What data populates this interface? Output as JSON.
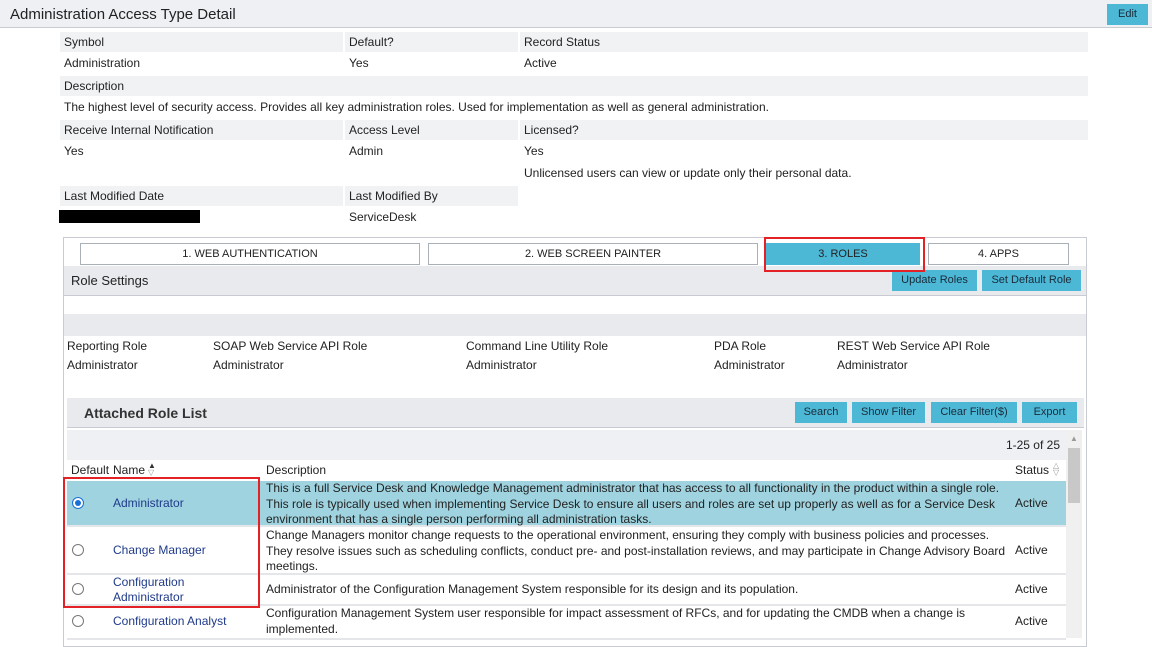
{
  "header": {
    "title": "Administration Access Type Detail",
    "edit_label": "Edit"
  },
  "detail": {
    "symbol_label": "Symbol",
    "symbol": "Administration",
    "default_label": "Default?",
    "default": "Yes",
    "record_status_label": "Record Status",
    "record_status": "Active",
    "description_label": "Description",
    "description": "The highest level of security access. Provides all key administration roles. Used for implementation as well as general administration.",
    "notification_label": "Receive Internal Notification",
    "notification": "Yes",
    "access_level_label": "Access Level",
    "access_level": "Admin",
    "licensed_label": "Licensed?",
    "licensed": "Yes",
    "licensed_note": "Unlicensed users can view or update only their personal data.",
    "modified_date_label": "Last Modified Date",
    "modified_by_label": "Last Modified By",
    "modified_by": "ServiceDesk"
  },
  "tabs": [
    {
      "label": "1. WEB AUTHENTICATION"
    },
    {
      "label": "2. WEB SCREEN PAINTER"
    },
    {
      "label": "3. ROLES"
    },
    {
      "label": "4. APPS"
    }
  ],
  "role_settings": {
    "title": "Role Settings",
    "update_roles": "Update Roles",
    "set_default_role": "Set Default Role"
  },
  "roles": [
    {
      "label": "Reporting Role",
      "value": "Administrator"
    },
    {
      "label": "SOAP Web Service API Role",
      "value": "Administrator"
    },
    {
      "label": "Command Line Utility Role",
      "value": "Administrator"
    },
    {
      "label": "PDA Role",
      "value": "Administrator"
    },
    {
      "label": "REST Web Service API Role",
      "value": "Administrator"
    }
  ],
  "role_list": {
    "title": "Attached Role List",
    "search": "Search",
    "show_filter": "Show Filter",
    "clear_filter": "Clear Filter($)",
    "export": "Export",
    "pagination": "1-25 of 25",
    "columns": {
      "default": "Default",
      "name": "Name",
      "description": "Description",
      "status": "Status"
    },
    "rows": [
      {
        "name": "Administrator",
        "description": "This is a full Service Desk and Knowledge Management administrator that has access to all functionality in the product within a single role. This role is typically used when implementing Service Desk to ensure all users and roles are set up properly as well as for a Service Desk environment that has a single person performing all administration tasks.",
        "status": "Active",
        "default": true
      },
      {
        "name": "Change Manager",
        "description": "Change Managers monitor change requests to the operational environment, ensuring they comply with business policies and processes. They resolve issues such as scheduling conflicts, conduct pre- and post-installation reviews, and may participate in Change Advisory Board meetings.",
        "status": "Active",
        "default": false
      },
      {
        "name": "Configuration Administrator",
        "description": "Administrator of the Configuration Management System responsible for its design and its population.",
        "status": "Active",
        "default": false
      },
      {
        "name": "Configuration Analyst",
        "description": "Configuration Management System user responsible for impact assessment of RFCs, and for updating the CMDB when a change is implemented.",
        "status": "Active",
        "default": false
      }
    ]
  },
  "colors": {
    "accent": "#4cb8d6",
    "selected_row": "#9fd3df",
    "highlight": "#e32228"
  }
}
